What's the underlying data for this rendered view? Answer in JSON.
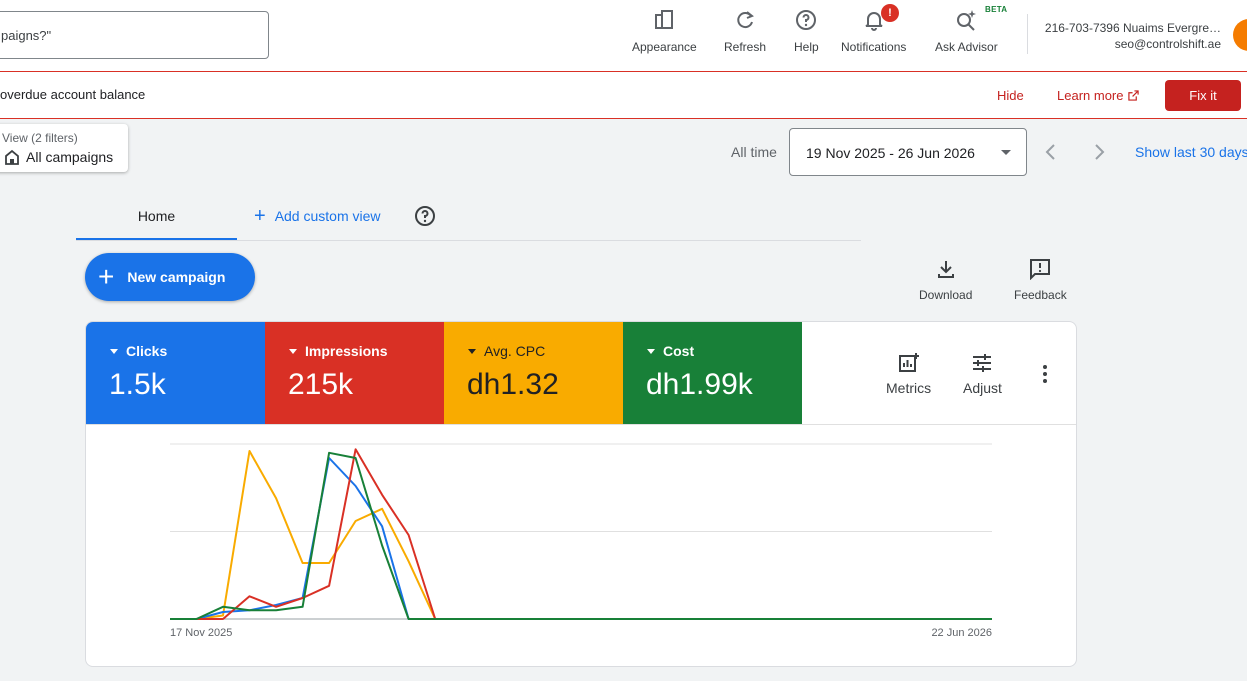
{
  "search": {
    "text": "paigns?\""
  },
  "toolbar": {
    "appearance": "Appearance",
    "refresh": "Refresh",
    "help": "Help",
    "notifications": "Notifications",
    "notifications_badge": "!",
    "ask_advisor": "Ask Advisor",
    "beta_badge": "BETA"
  },
  "account": {
    "name": "216-703-7396 Nuaims Evergre…",
    "email": "seo@controlshift.ae"
  },
  "alert": {
    "text": "overdue account balance",
    "hide": "Hide",
    "learn_more": "Learn more",
    "fix_it": "Fix it"
  },
  "view": {
    "filters": "View (2 filters)",
    "name": "All campaigns"
  },
  "date": {
    "label": "All time",
    "range": "19 Nov 2025 - 26 Jun 2026",
    "show_last": "Show last 30 days"
  },
  "tabs": {
    "home": "Home",
    "add_custom": "Add custom view"
  },
  "actions": {
    "new_campaign": "New campaign",
    "download": "Download",
    "feedback": "Feedback"
  },
  "metrics": [
    {
      "label": "Clicks",
      "value": "1.5k",
      "color": "#1a73e8"
    },
    {
      "label": "Impressions",
      "value": "215k",
      "color": "#d93025"
    },
    {
      "label": "Avg. CPC",
      "value": "dh1.32",
      "color": "#f9ab00"
    },
    {
      "label": "Cost",
      "value": "dh1.99k",
      "color": "#188038"
    }
  ],
  "metric_tools": {
    "metrics": "Metrics",
    "adjust": "Adjust"
  },
  "chart_data": {
    "type": "line",
    "x_start_label": "17 Nov 2025",
    "x_end_label": "22 Jun 2026",
    "grid": true,
    "y_max": 1,
    "points_count": 32,
    "series": [
      {
        "color": "#f9ab00",
        "values": [
          0,
          0,
          0.02,
          0.96,
          0.69,
          0.32,
          0.32,
          0.56,
          0.63,
          0.33,
          0,
          0,
          0,
          0,
          0,
          0,
          0,
          0,
          0,
          0,
          0,
          0,
          0,
          0,
          0,
          0,
          0,
          0,
          0,
          0,
          0,
          0
        ]
      },
      {
        "color": "#1a73e8",
        "values": [
          0,
          0,
          0.04,
          0.05,
          0.08,
          0.12,
          0.92,
          0.76,
          0.53,
          0,
          0,
          0,
          0,
          0,
          0,
          0,
          0,
          0,
          0,
          0,
          0,
          0,
          0,
          0,
          0,
          0,
          0,
          0,
          0,
          0,
          0,
          0
        ]
      },
      {
        "color": "#d93025",
        "values": [
          0,
          0,
          0,
          0.13,
          0.07,
          0.12,
          0.19,
          0.97,
          0.71,
          0.48,
          0,
          0,
          0,
          0,
          0,
          0,
          0,
          0,
          0,
          0,
          0,
          0,
          0,
          0,
          0,
          0,
          0,
          0,
          0,
          0,
          0,
          0
        ]
      },
      {
        "color": "#188038",
        "values": [
          0,
          0,
          0.07,
          0.05,
          0.05,
          0.07,
          0.95,
          0.92,
          0.42,
          0,
          0,
          0,
          0,
          0,
          0,
          0,
          0,
          0,
          0,
          0,
          0,
          0,
          0,
          0,
          0,
          0,
          0,
          0,
          0,
          0,
          0,
          0
        ]
      }
    ]
  }
}
